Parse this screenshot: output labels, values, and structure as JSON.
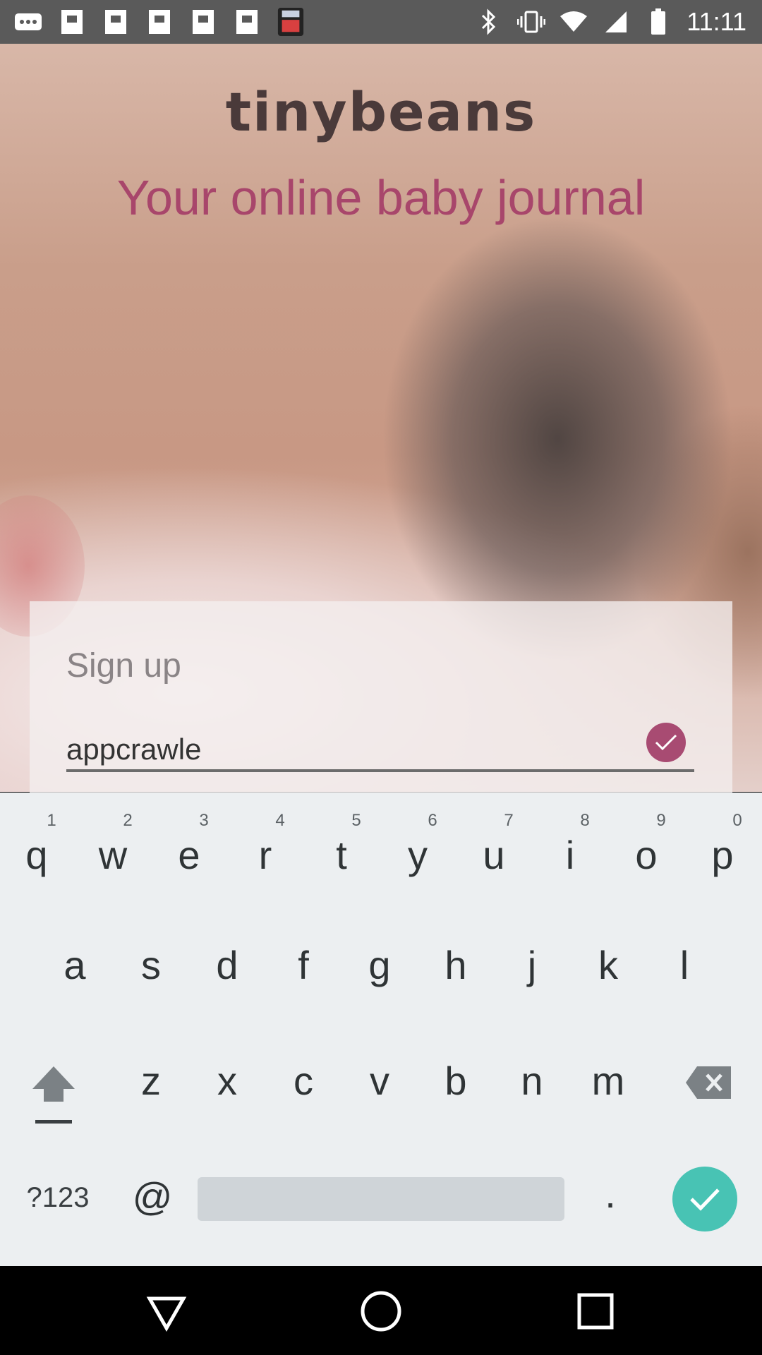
{
  "status_bar": {
    "time": "11:11",
    "left_icons": [
      "more-icon",
      "photo-icon",
      "photo-icon",
      "photo-icon",
      "photo-icon",
      "photo-icon",
      "app-thumbnail-icon"
    ],
    "right_icons": [
      "bluetooth-icon",
      "vibrate-icon",
      "wifi-icon",
      "signal-icon",
      "battery-icon"
    ]
  },
  "hero": {
    "logo": "tinybeans",
    "tagline": "Your online baby journal"
  },
  "signup": {
    "title": "Sign up",
    "username_value": "appcrawle",
    "valid": true
  },
  "keyboard": {
    "row1": [
      {
        "key": "q",
        "hint": "1"
      },
      {
        "key": "w",
        "hint": "2"
      },
      {
        "key": "e",
        "hint": "3"
      },
      {
        "key": "r",
        "hint": "4"
      },
      {
        "key": "t",
        "hint": "5"
      },
      {
        "key": "y",
        "hint": "6"
      },
      {
        "key": "u",
        "hint": "7"
      },
      {
        "key": "i",
        "hint": "8"
      },
      {
        "key": "o",
        "hint": "9"
      },
      {
        "key": "p",
        "hint": "0"
      }
    ],
    "row2": [
      "a",
      "s",
      "d",
      "f",
      "g",
      "h",
      "j",
      "k",
      "l"
    ],
    "row3": [
      "z",
      "x",
      "c",
      "v",
      "b",
      "n",
      "m"
    ],
    "symbols": "?123",
    "at": "@",
    "period": "."
  },
  "colors": {
    "brand_text": "#a8466b",
    "check_badge": "#a84b72",
    "enter_key": "#48c3b4"
  }
}
